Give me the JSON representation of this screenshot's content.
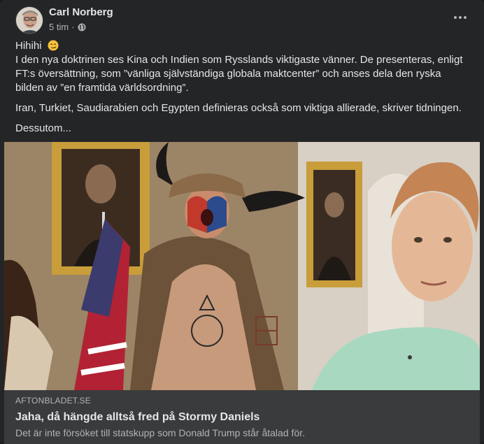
{
  "post": {
    "author": "Carl Norberg",
    "time": "5 tim",
    "separator": "·",
    "privacy_icon": "globe-icon",
    "more_icon": "more-options-icon",
    "paragraphs": [
      "Hihihi",
      "I den nya doktrinen ses Kina och Indien som Rysslands viktigaste vänner. De presenteras, enligt FT:s översättning, som ”vänliga självständiga globala maktcenter” och anses dela den ryska bilden av ”en framtida världsordning”.",
      "Iran, Turkiet, Saudiarabien och Egypten definieras också som viktiga allierade, skriver tidningen.",
      "Dessutom..."
    ],
    "emoji": "smirk-emoji"
  },
  "link": {
    "domain": "AFTONBLADET.SE",
    "title": "Jaha, då hängde alltså fred på Stormy Daniels",
    "description": "Det är inte försöket till statskupp som Donald Trump står åtalad för."
  },
  "colors": {
    "card_bg": "#242526",
    "link_bg": "#3a3b3c",
    "primary_text": "#e4e6eb",
    "secondary_text": "#b0b3b8"
  }
}
